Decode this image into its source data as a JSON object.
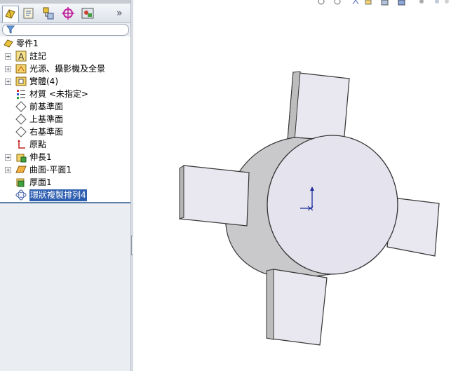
{
  "tree": {
    "root_label": "零件1",
    "items": [
      {
        "label": "註記",
        "icon": "annotations-icon",
        "expandable": true
      },
      {
        "label": "光源、攝影機及全景",
        "icon": "lights-cameras-icon",
        "expandable": true
      },
      {
        "label": "實體(4)",
        "icon": "solid-bodies-icon",
        "expandable": true
      },
      {
        "label": "材質 <未指定>",
        "icon": "material-icon",
        "expandable": false
      },
      {
        "label": "前基準面",
        "icon": "plane-icon",
        "expandable": false
      },
      {
        "label": "上基準面",
        "icon": "plane-icon",
        "expandable": false
      },
      {
        "label": "右基準面",
        "icon": "plane-icon",
        "expandable": false
      },
      {
        "label": "原點",
        "icon": "origin-icon",
        "expandable": false
      },
      {
        "label": "伸長1",
        "icon": "extrude-icon",
        "expandable": true
      },
      {
        "label": "曲面-平面1",
        "icon": "planar-surface-icon",
        "expandable": true
      },
      {
        "label": "厚面1",
        "icon": "thicken-icon",
        "expandable": false
      },
      {
        "label": "環狀複製排列4",
        "icon": "circular-pattern-icon",
        "expandable": false,
        "selected": true
      }
    ]
  },
  "tabs": [
    "feature-manager-tab",
    "property-manager-tab",
    "configuration-manager-tab",
    "dimxpert-manager-tab",
    "display-manager-tab"
  ],
  "more_glyph": "»",
  "colors": {
    "selection": "#2f5fb0",
    "model_face": "#e4e3ee",
    "model_side": "#c9c9cc"
  }
}
